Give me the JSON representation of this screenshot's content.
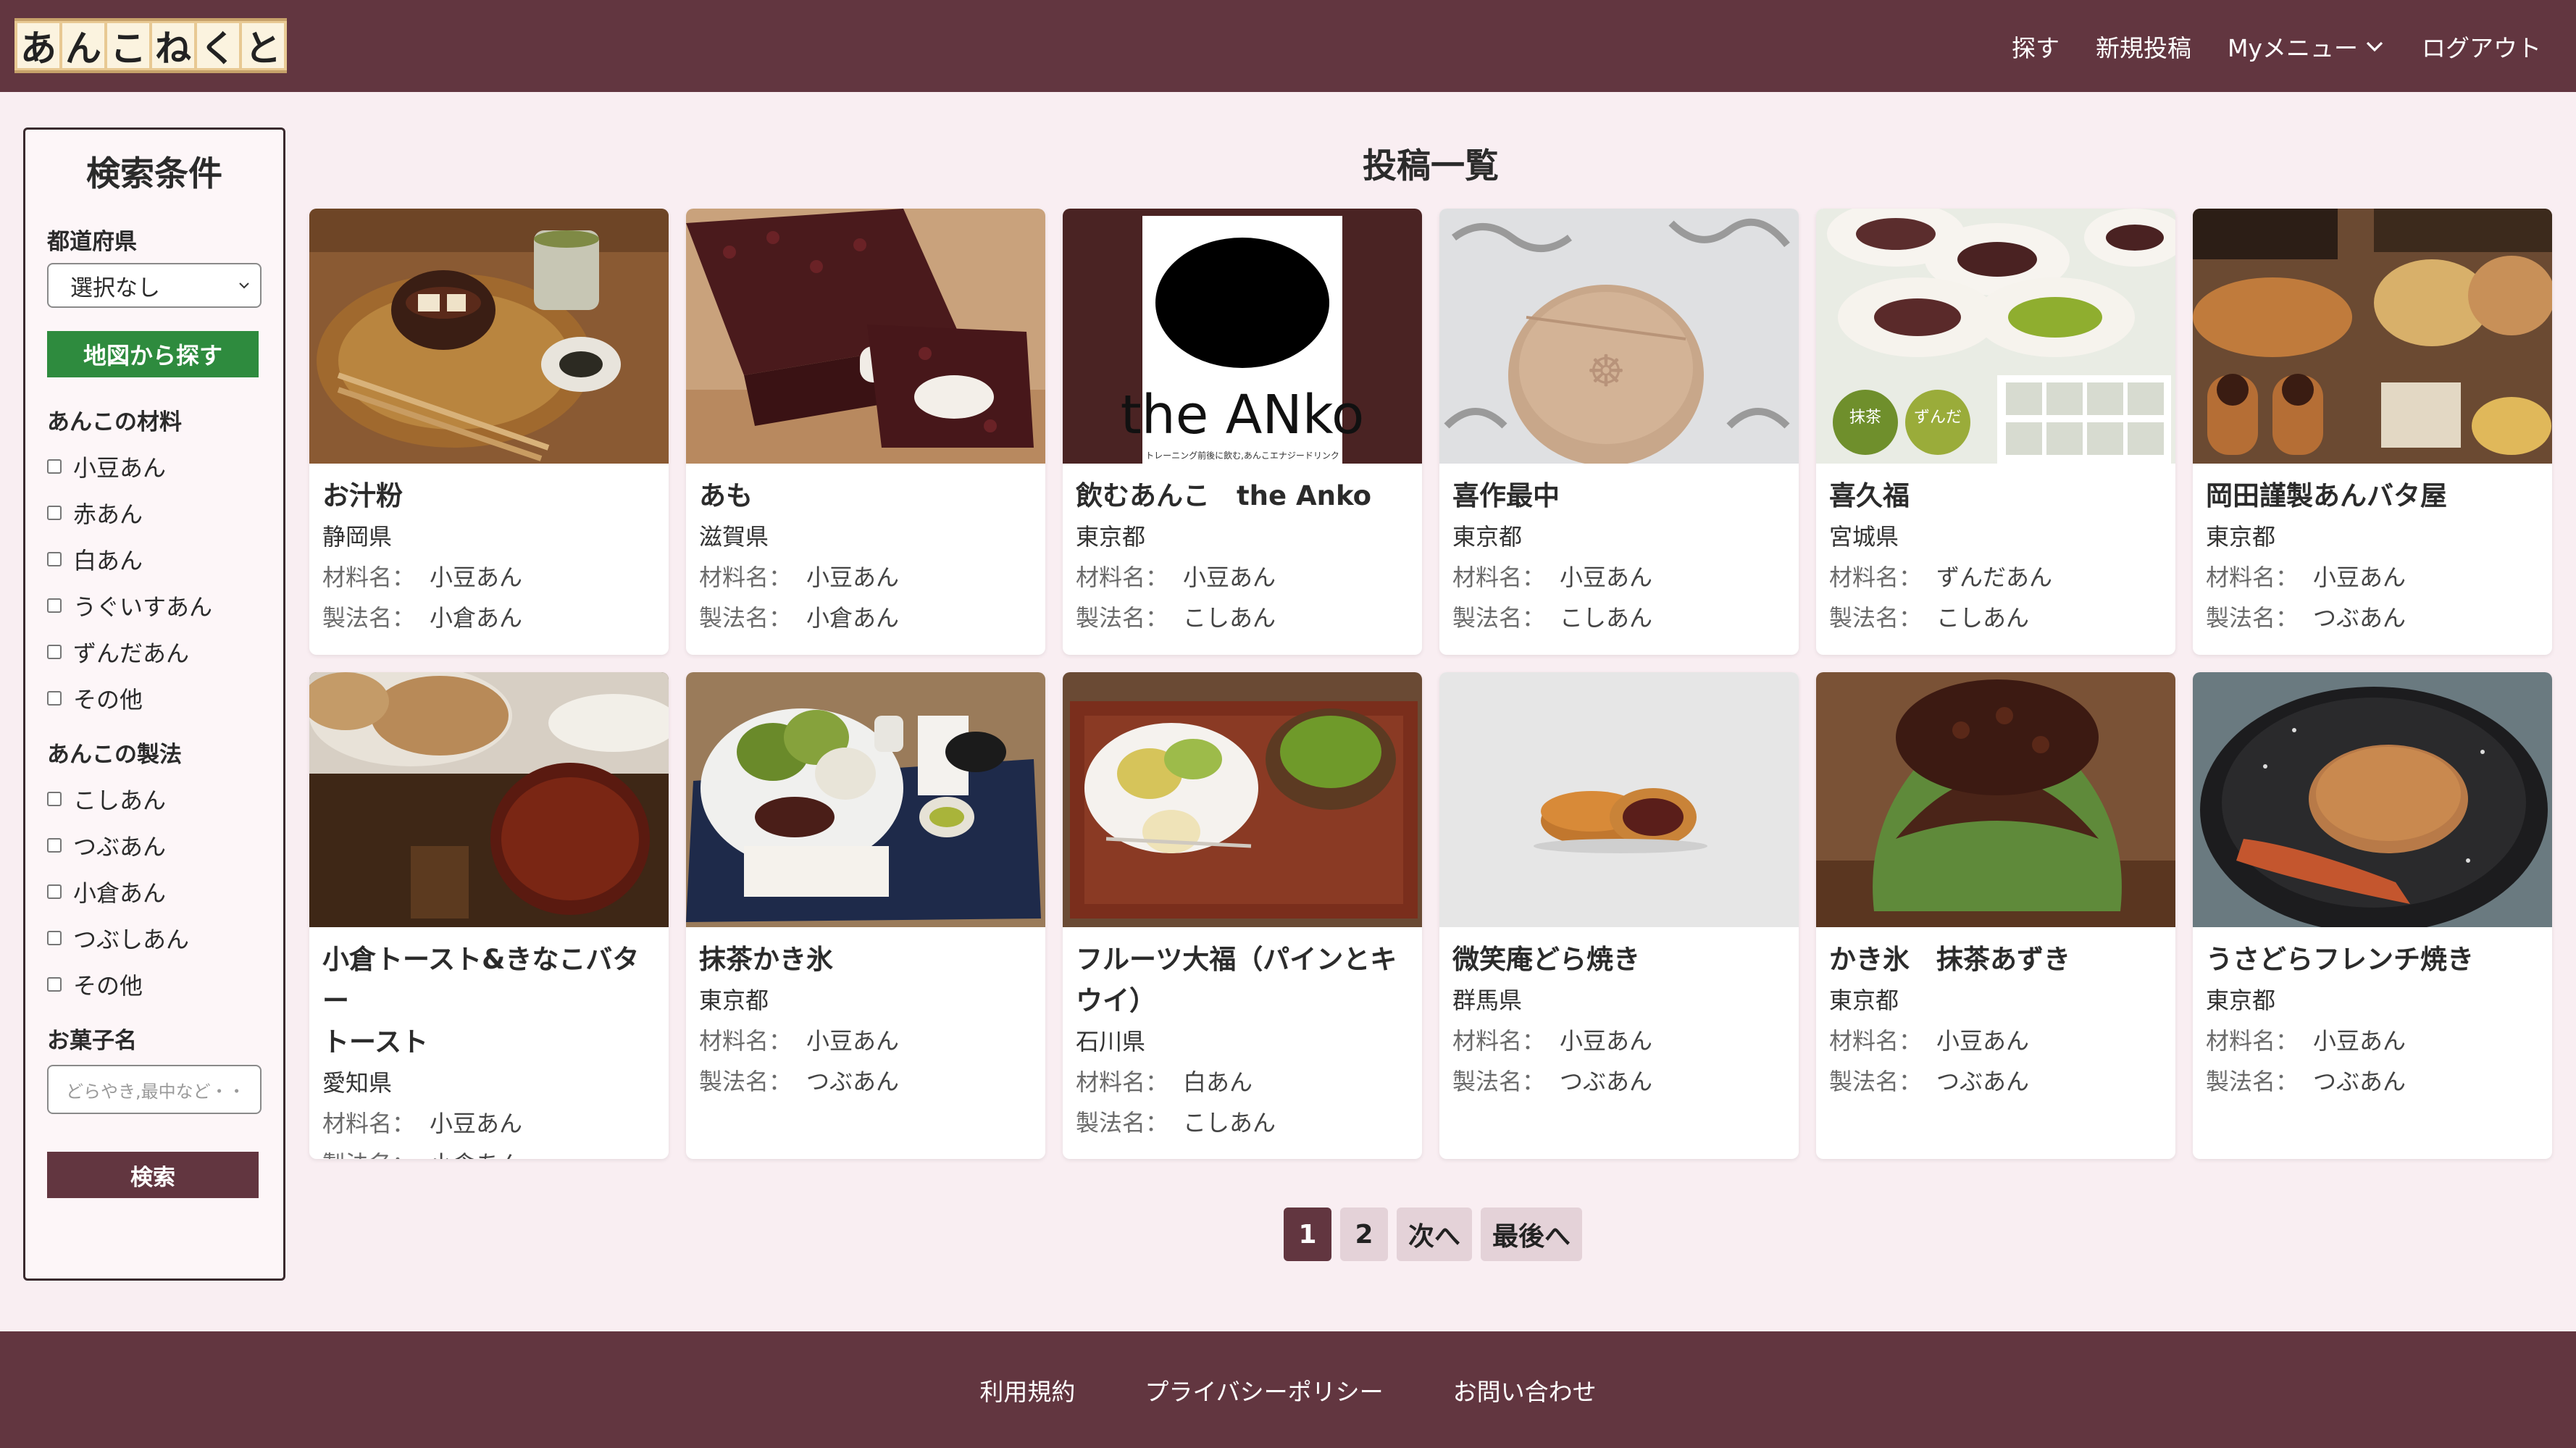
{
  "header": {
    "logo_chars": [
      "あ",
      "ん",
      "こ",
      "ね",
      "く",
      "と"
    ],
    "nav": {
      "search": "探す",
      "new_post": "新規投稿",
      "my_menu": "Myメニュー",
      "logout": "ログアウト"
    }
  },
  "sidebar": {
    "title": "検索条件",
    "prefecture_label": "都道府県",
    "prefecture_value": "選択なし",
    "map_button": "地図から探す",
    "material_label": "あんこの材料",
    "materials": [
      "小豆あん",
      "赤あん",
      "白あん",
      "うぐいすあん",
      "ずんだあん",
      "その他"
    ],
    "method_label": "あんこの製法",
    "methods": [
      "こしあん",
      "つぶあん",
      "小倉あん",
      "つぶしあん",
      "その他"
    ],
    "name_label": "お菓子名",
    "name_placeholder": "どらやき,最中など・・",
    "search_button": "検索"
  },
  "main": {
    "title": "投稿一覧",
    "material_key": "材料名：",
    "method_key": "製法名：",
    "posts": [
      {
        "title": "お汁粉",
        "pref": "静岡県",
        "material": "小豆あん",
        "method": "小倉あん"
      },
      {
        "title": "あも",
        "pref": "滋賀県",
        "material": "小豆あん",
        "method": "小倉あん"
      },
      {
        "title": "飲むあんこ　the Anko",
        "pref": "東京都",
        "material": "小豆あん",
        "method": "こしあん",
        "img_text": "the ANko",
        "img_sub": "トレーニング前後に飲む,あんこエナジードリンク"
      },
      {
        "title": "喜作最中",
        "pref": "東京都",
        "material": "小豆あん",
        "method": "こしあん"
      },
      {
        "title": "喜久福",
        "pref": "宮城県",
        "material": "ずんだあん",
        "method": "こしあん",
        "img_badges": [
          "抹茶",
          "ずんだ"
        ]
      },
      {
        "title": "岡田謹製あんバタ屋",
        "pref": "東京都",
        "material": "小豆あん",
        "method": "つぶあん"
      },
      {
        "title": "小倉トースト&きなこバタートースト",
        "title_lines": [
          "小倉トースト&きなこバター",
          "トースト"
        ],
        "pref": "愛知県",
        "material": "小豆あん",
        "method": "小倉あん"
      },
      {
        "title": "抹茶かき氷",
        "pref": "東京都",
        "material": "小豆あん",
        "method": "つぶあん"
      },
      {
        "title": "フルーツ大福（パインとキウイ）",
        "title_lines": [
          "フルーツ大福（パインとキ",
          "ウイ）"
        ],
        "pref": "石川県",
        "material": "白あん",
        "method": "こしあん"
      },
      {
        "title": "微笑庵どら焼き",
        "pref": "群馬県",
        "material": "小豆あん",
        "method": "つぶあん"
      },
      {
        "title": "かき氷　抹茶あずき",
        "pref": "東京都",
        "material": "小豆あん",
        "method": "つぶあん"
      },
      {
        "title": "うさどらフレンチ焼き",
        "pref": "東京都",
        "material": "小豆あん",
        "method": "つぶあん"
      }
    ]
  },
  "pagination": {
    "pages": [
      "1",
      "2"
    ],
    "next": "次へ",
    "last": "最後へ",
    "current": "1"
  },
  "footer": {
    "links": [
      "利用規約",
      "プライバシーポリシー",
      "お問い合わせ"
    ]
  },
  "colors": {
    "brand": "#623640",
    "background": "#f9eef2",
    "map_button": "#2e8b3e"
  }
}
